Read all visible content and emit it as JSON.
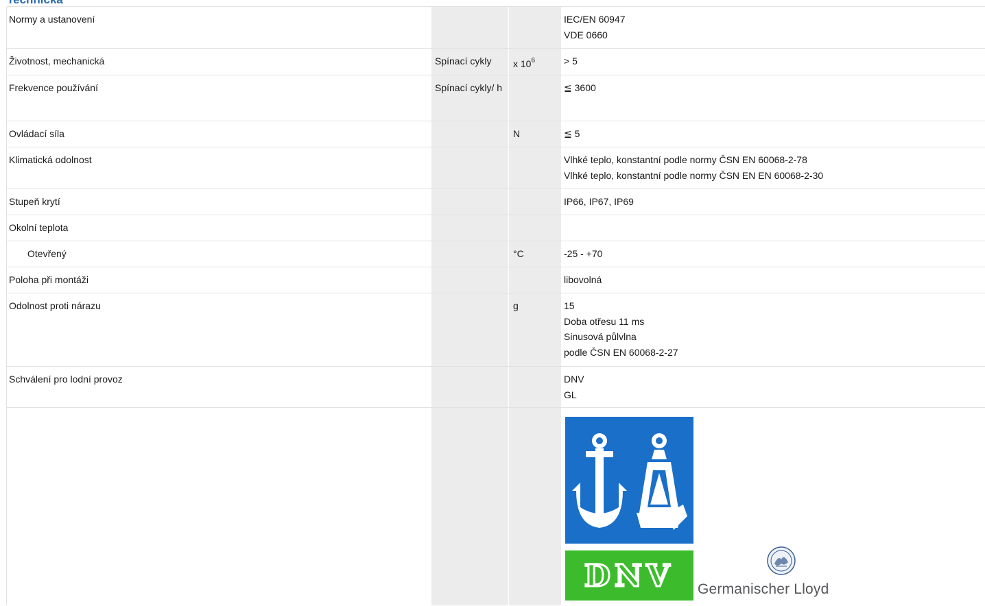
{
  "section": {
    "title": "Technická"
  },
  "rows": [
    {
      "label": "Normy a ustanovení",
      "unit_text": "",
      "unit": "",
      "values": [
        "IEC/EN 60947",
        "VDE 0660"
      ]
    },
    {
      "label": "Životnost, mechanická",
      "unit_text": "Spínací cykly",
      "unit": "x 10",
      "unit_sup": "6",
      "values": [
        "> 5"
      ]
    },
    {
      "label": "Frekvence používání",
      "unit_text": "Spínací cykly/ h",
      "unit": "",
      "values": [
        "≦ 3600"
      ]
    },
    {
      "label": "Ovládací síla",
      "unit_text": "",
      "unit": "N",
      "values": [
        "≦ 5"
      ]
    },
    {
      "label": "Klimatická odolnost",
      "unit_text": "",
      "unit": "",
      "values": [
        "Vlhké teplo, konstantní podle normy ČSN EN 60068-2-78",
        "Vlhké teplo, konstantní podle normy ČSN EN EN 60068-2-30"
      ]
    },
    {
      "label": "Stupeň krytí",
      "unit_text": "",
      "unit": "",
      "values": [
        "IP66, IP67, IP69"
      ]
    },
    {
      "label": "Okolní teplota",
      "unit_text": "",
      "unit": "",
      "values": []
    },
    {
      "label": "Otevřený",
      "unit_text": "",
      "unit": "°C",
      "values": [
        "-25 - +70"
      ]
    },
    {
      "label": "Poloha při montáži",
      "unit_text": "",
      "unit": "",
      "values": [
        "libovolná"
      ]
    },
    {
      "label": "Odolnost proti nárazu",
      "unit_text": "",
      "unit": "g",
      "values": [
        "15",
        "Doba otřesu 11 ms",
        "Sinusová půlvlna",
        "podle ČSN EN 60068-2-27"
      ]
    },
    {
      "label": "Schválení pro lodní provoz",
      "unit_text": "",
      "unit": "",
      "values": [
        "DNV",
        "GL"
      ]
    }
  ],
  "logos": {
    "dnv_text": "DNV",
    "gl_text": "Germanischer Lloyd",
    "colors": {
      "anchor_bg": "#1a6fc9",
      "dnv_bg": "#3cbc2c",
      "gl_text": "#55565a"
    }
  }
}
